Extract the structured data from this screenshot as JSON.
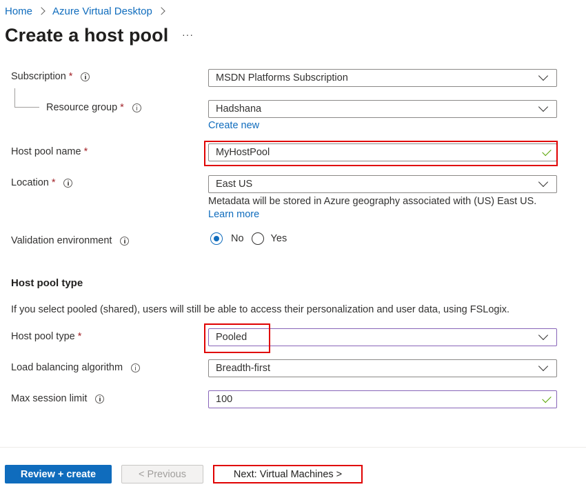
{
  "breadcrumb": {
    "home": "Home",
    "parent": "Azure Virtual Desktop"
  },
  "page": {
    "title": "Create a host pool",
    "more": "···"
  },
  "form": {
    "required_mark": "*",
    "subscription": {
      "label": "Subscription",
      "value": "MSDN Platforms Subscription"
    },
    "resource_group": {
      "label": "Resource group",
      "value": "Hadshana",
      "create_new": "Create new"
    },
    "host_pool_name": {
      "label": "Host pool name",
      "value": "MyHostPool",
      "valid": true
    },
    "location": {
      "label": "Location",
      "value": "East US",
      "help": "Metadata will be stored in Azure geography associated with (US) East US.",
      "learn_more": "Learn more"
    },
    "validation_environment": {
      "label": "Validation environment",
      "options": [
        "No",
        "Yes"
      ],
      "selected": "No"
    }
  },
  "host_pool_type_section": {
    "heading": "Host pool type",
    "description": "If you select pooled (shared), users will still be able to access their personalization and user data, using FSLogix.",
    "host_pool_type": {
      "label": "Host pool type",
      "value": "Pooled"
    },
    "load_balancing": {
      "label": "Load balancing algorithm",
      "value": "Breadth-first"
    },
    "max_session_limit": {
      "label": "Max session limit",
      "value": "100",
      "valid": true
    }
  },
  "footer": {
    "review_create": "Review + create",
    "previous": "< Previous",
    "next": "Next: Virtual Machines >"
  },
  "colors": {
    "accent": "#0f6cbd",
    "required": "#a4262c",
    "highlight": "#e00000",
    "valid": "#57a300",
    "focus_border": "#8764b8"
  }
}
